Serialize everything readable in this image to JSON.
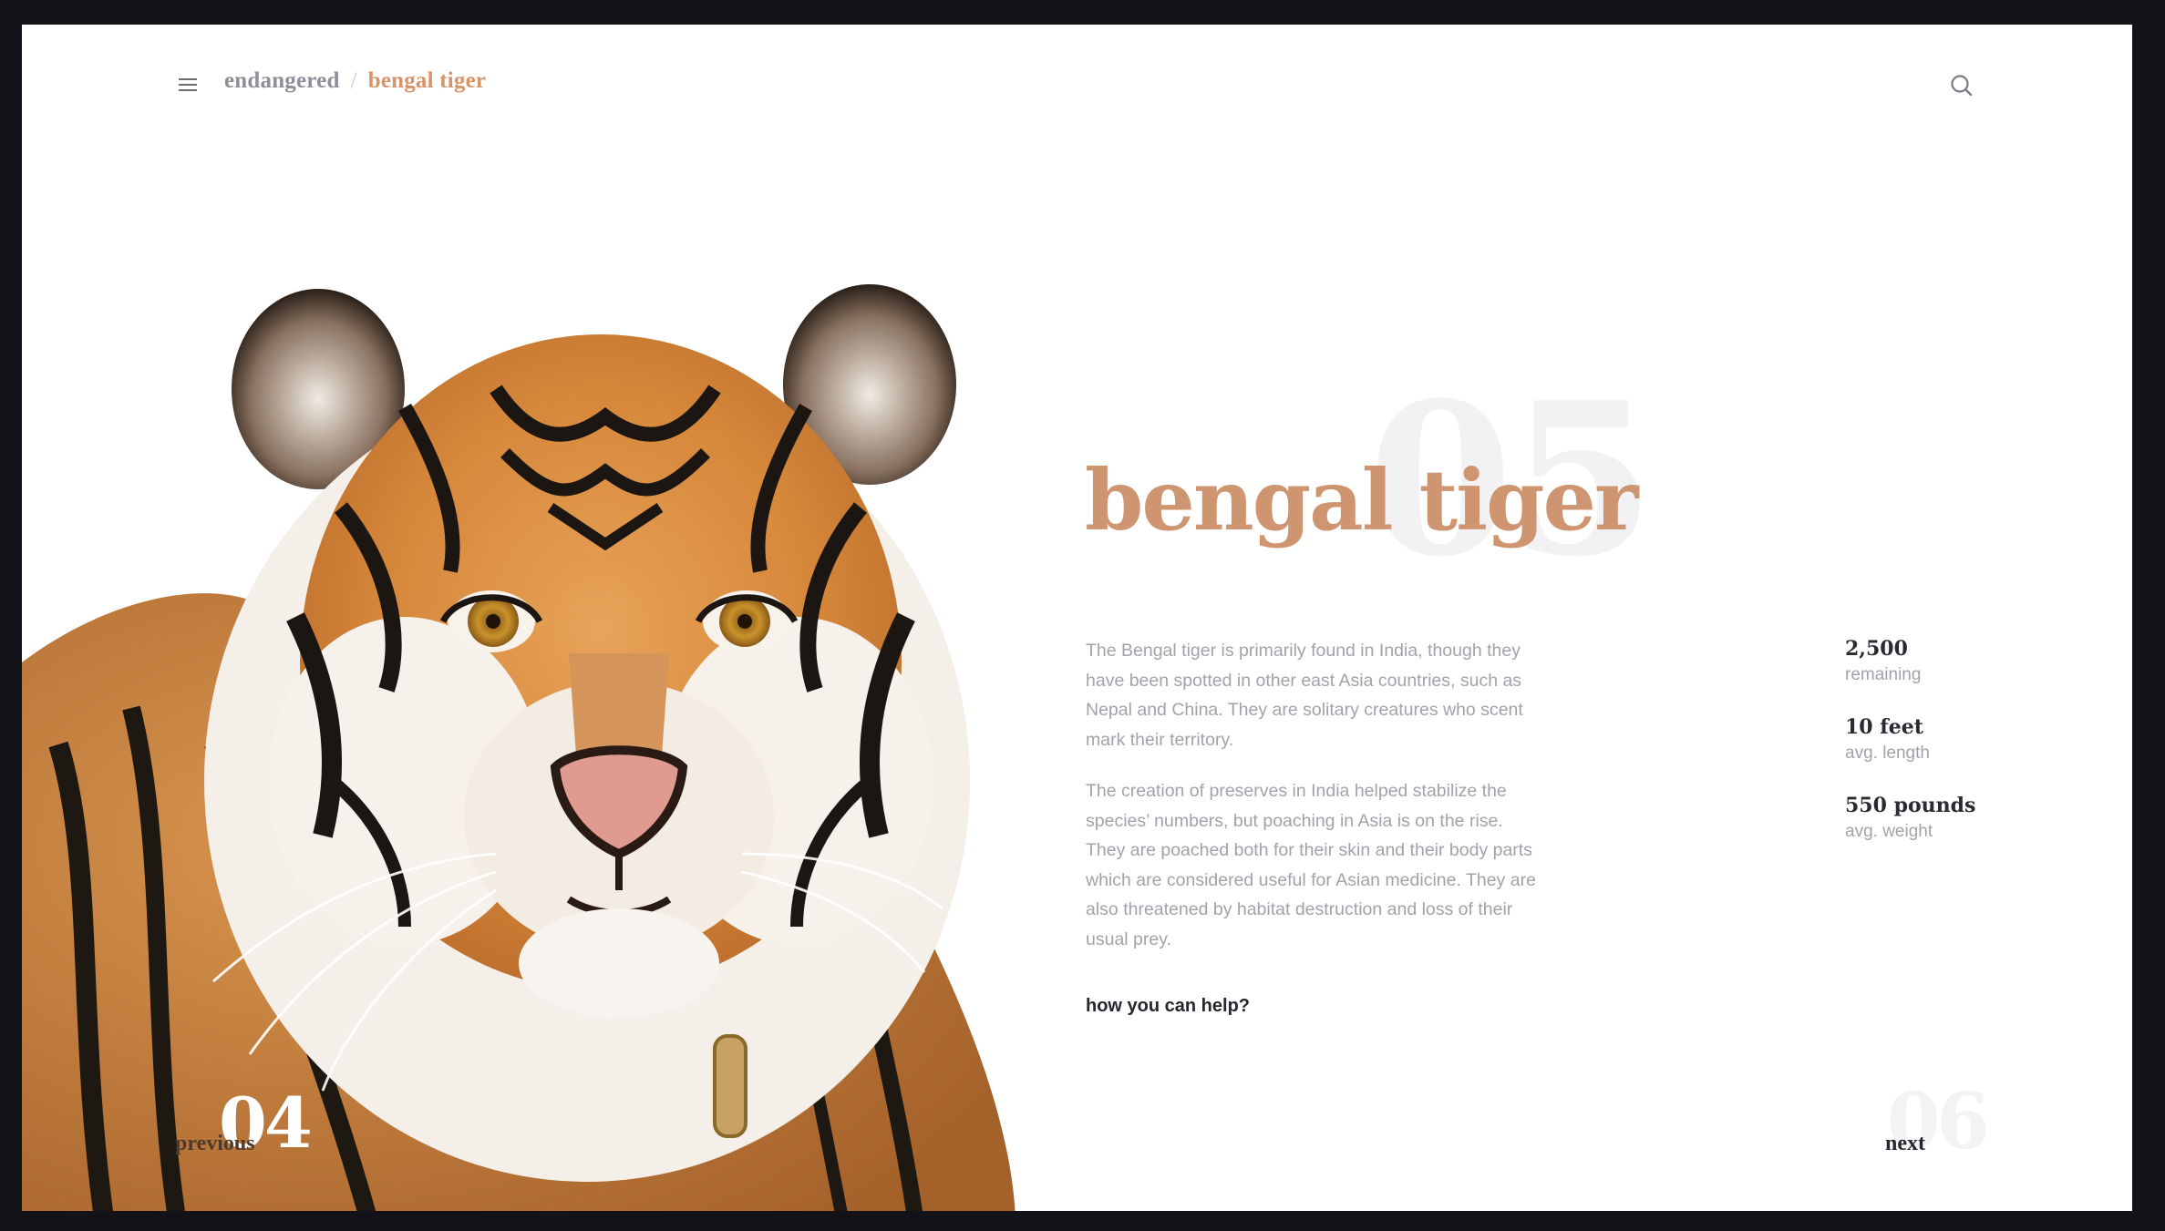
{
  "header": {
    "breadcrumb_root": "endangered",
    "breadcrumb_separator": "/",
    "breadcrumb_current": "bengal tiger",
    "menu_icon": "hamburger-menu-icon",
    "search_icon": "search-icon"
  },
  "hero": {
    "image": "bengal-tiger-portrait",
    "index_number": "05"
  },
  "content": {
    "title": "bengal tiger",
    "paragraphs": [
      "The Bengal tiger is primarily found in India, though they have been spotted in other east Asia countries, such as Nepal and China. They are solitary creatures who scent mark their territory.",
      "The creation of preserves in India helped stabilize the species’ numbers, but poaching in Asia is on the rise. They are poached both for their skin and their body parts which are considered useful for Asian medicine. They are also threatened by habitat destruction and loss of their usual prey."
    ],
    "help_link": "how you can help?"
  },
  "stats": [
    {
      "value": "2,500",
      "label": "remaining"
    },
    {
      "value": "10 feet",
      "label": "avg. length"
    },
    {
      "value": "550 pounds",
      "label": "avg. weight"
    }
  ],
  "navigation": {
    "previous_label": "previous",
    "previous_number": "04",
    "next_label": "next",
    "next_number": "06"
  },
  "colors": {
    "accent": "#cf9570",
    "frame_background": "#121218",
    "page_background": "#ffffff"
  }
}
